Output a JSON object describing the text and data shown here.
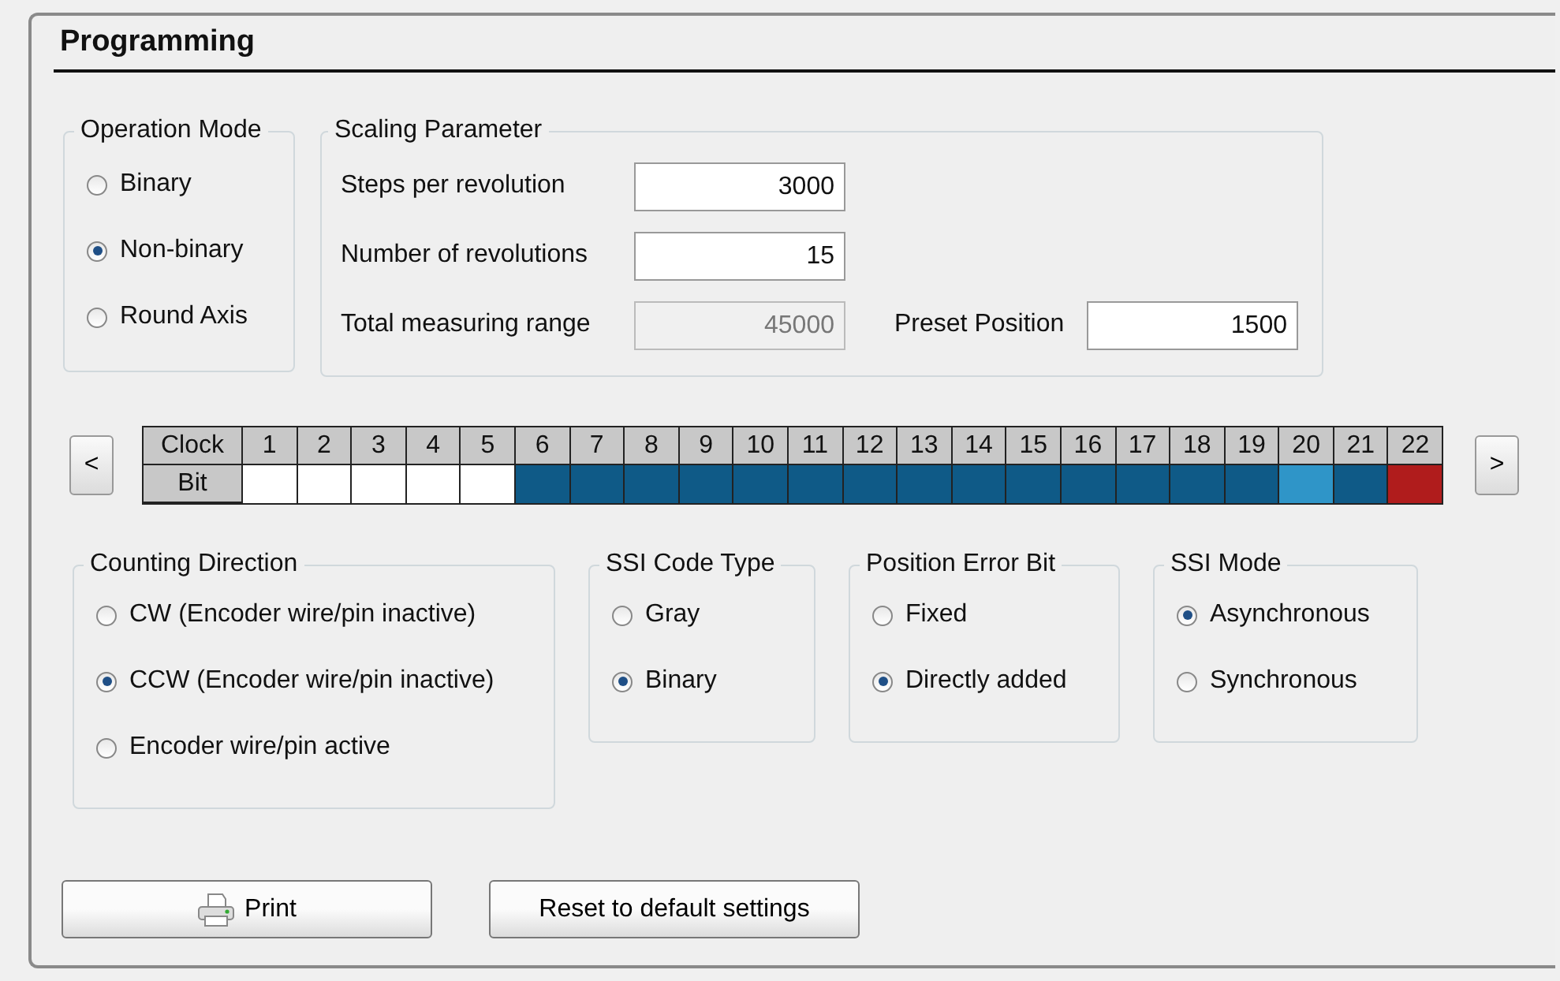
{
  "title": "Programming",
  "operation_mode": {
    "label": "Operation Mode",
    "options": [
      {
        "label": "Binary",
        "selected": false
      },
      {
        "label": "Non-binary",
        "selected": true
      },
      {
        "label": "Round Axis",
        "selected": false
      }
    ]
  },
  "scaling": {
    "label": "Scaling Parameter",
    "fields": [
      {
        "label": "Steps per revolution",
        "value": "3000",
        "disabled": false
      },
      {
        "label": "Number of revolutions",
        "value": "15",
        "disabled": false
      },
      {
        "label": "Total measuring range",
        "value": "45000",
        "disabled": true
      }
    ],
    "preset": {
      "label": "Preset Position",
      "value": "1500"
    }
  },
  "bit_table": {
    "prev": "<",
    "next": ">",
    "clock_label": "Clock",
    "bit_label": "Bit",
    "bits": [
      {
        "clock": "1",
        "color": "#ffffff"
      },
      {
        "clock": "2",
        "color": "#ffffff"
      },
      {
        "clock": "3",
        "color": "#ffffff"
      },
      {
        "clock": "4",
        "color": "#ffffff"
      },
      {
        "clock": "5",
        "color": "#ffffff"
      },
      {
        "clock": "6",
        "color": "#0f5a87"
      },
      {
        "clock": "7",
        "color": "#0f5a87"
      },
      {
        "clock": "8",
        "color": "#0f5a87"
      },
      {
        "clock": "9",
        "color": "#0f5a87"
      },
      {
        "clock": "10",
        "color": "#0f5a87"
      },
      {
        "clock": "11",
        "color": "#0f5a87"
      },
      {
        "clock": "12",
        "color": "#0f5a87"
      },
      {
        "clock": "13",
        "color": "#0f5a87"
      },
      {
        "clock": "14",
        "color": "#0f5a87"
      },
      {
        "clock": "15",
        "color": "#0f5a87"
      },
      {
        "clock": "16",
        "color": "#0f5a87"
      },
      {
        "clock": "17",
        "color": "#0f5a87"
      },
      {
        "clock": "18",
        "color": "#0f5a87"
      },
      {
        "clock": "19",
        "color": "#0f5a87"
      },
      {
        "clock": "20",
        "color": "#2f95c8"
      },
      {
        "clock": "21",
        "color": "#0f5a87"
      },
      {
        "clock": "22",
        "color": "#b01c1c"
      }
    ]
  },
  "groups": [
    {
      "label": "Counting Direction",
      "options": [
        {
          "label": "CW (Encoder wire/pin inactive)",
          "selected": false
        },
        {
          "label": "CCW (Encoder wire/pin inactive)",
          "selected": true
        },
        {
          "label": "Encoder wire/pin active",
          "selected": false
        }
      ]
    },
    {
      "label": "SSI Code Type",
      "options": [
        {
          "label": "Gray",
          "selected": false
        },
        {
          "label": "Binary",
          "selected": true
        }
      ]
    },
    {
      "label": "Position Error Bit",
      "options": [
        {
          "label": "Fixed",
          "selected": false
        },
        {
          "label": "Directly added",
          "selected": true
        }
      ]
    },
    {
      "label": "SSI Mode",
      "options": [
        {
          "label": "Asynchronous",
          "selected": true
        },
        {
          "label": "Synchronous",
          "selected": false
        }
      ]
    }
  ],
  "buttons": [
    {
      "label": "Print",
      "kind": "print"
    },
    {
      "label": "Reset to default settings",
      "kind": "plain"
    }
  ]
}
